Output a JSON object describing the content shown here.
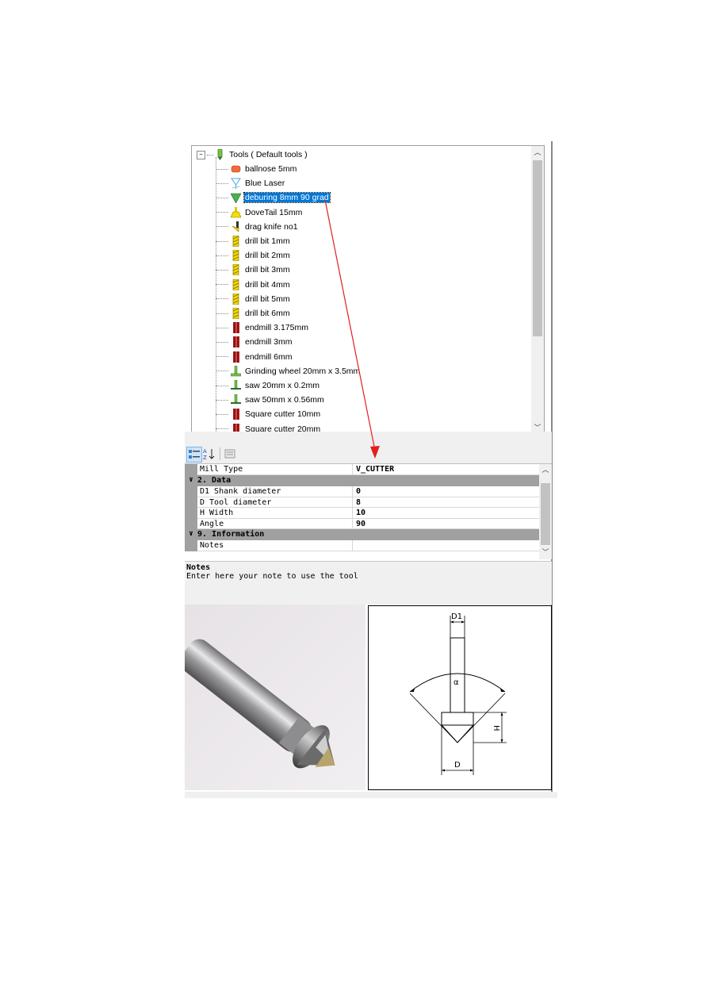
{
  "tree": {
    "root_label": "Tools  ( Default tools )",
    "items": [
      {
        "label": "ballnose 5mm",
        "icon": "ballnose-icon"
      },
      {
        "label": "Blue Laser",
        "icon": "laser-icon"
      },
      {
        "label": "deburing 8mm 90 grad",
        "icon": "v-cutter-icon",
        "selected": true
      },
      {
        "label": "DoveTail 15mm",
        "icon": "dovetail-icon"
      },
      {
        "label": "drag knife no1",
        "icon": "drag-knife-icon"
      },
      {
        "label": "drill bit 1mm",
        "icon": "drill-icon"
      },
      {
        "label": "drill bit 2mm",
        "icon": "drill-icon"
      },
      {
        "label": "drill bit 3mm",
        "icon": "drill-icon"
      },
      {
        "label": "drill bit 4mm",
        "icon": "drill-icon"
      },
      {
        "label": "drill bit 5mm",
        "icon": "drill-icon"
      },
      {
        "label": "drill bit 6mm",
        "icon": "drill-icon"
      },
      {
        "label": "endmill 3.175mm",
        "icon": "endmill-icon"
      },
      {
        "label": "endmill 3mm",
        "icon": "endmill-icon"
      },
      {
        "label": "endmill 6mm",
        "icon": "endmill-icon"
      },
      {
        "label": "Grinding wheel 20mm x 3.5mm",
        "icon": "grinding-wheel-icon"
      },
      {
        "label": "saw 20mm x 0.2mm",
        "icon": "saw-icon"
      },
      {
        "label": "saw 50mm x 0.56mm",
        "icon": "saw-icon"
      },
      {
        "label": "Square cutter 10mm",
        "icon": "endmill-icon"
      },
      {
        "label": "Square cutter 20mm",
        "icon": "endmill-icon"
      }
    ]
  },
  "propgrid": {
    "mill_type_name": "Mill Type",
    "mill_type_value": "V_CUTTER",
    "cat_data": "2. Data",
    "rows": [
      {
        "name": "D1 Shank diameter",
        "value": "0"
      },
      {
        "name": "D  Tool diameter",
        "value": "8"
      },
      {
        "name": "H  Width",
        "value": "10"
      },
      {
        "name": "Angle",
        "value": "90"
      }
    ],
    "cat_info": "9. Information",
    "notes_name": "Notes",
    "notes_value": ""
  },
  "notes": {
    "title": "Notes",
    "text": "Enter here your note to use the tool"
  },
  "drawing": {
    "d1": "D1",
    "alpha": "α",
    "h": "H",
    "d": "D"
  },
  "colors": {
    "selection": "#0078d7",
    "arrow": "#e02020",
    "grid_category": "#a0a0a0"
  }
}
